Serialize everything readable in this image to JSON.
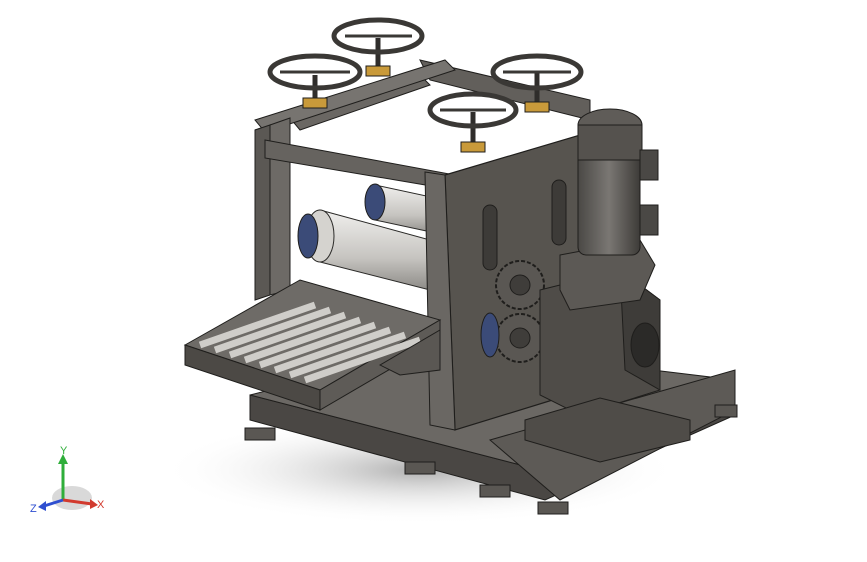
{
  "viewport": {
    "background": "#ffffff"
  },
  "model": {
    "frame_color": "#55524e",
    "gear_color": "#5a5753",
    "bearing_color": "#3b4b78",
    "roller_color": "#c9c7c3",
    "bolt_plate_color": "#c99a3a"
  },
  "triad": {
    "x_label": "X",
    "y_label": "Y",
    "z_label": "Z",
    "x_color": "#d23a2e",
    "y_color": "#2fae3a",
    "z_color": "#2f4fd0"
  }
}
